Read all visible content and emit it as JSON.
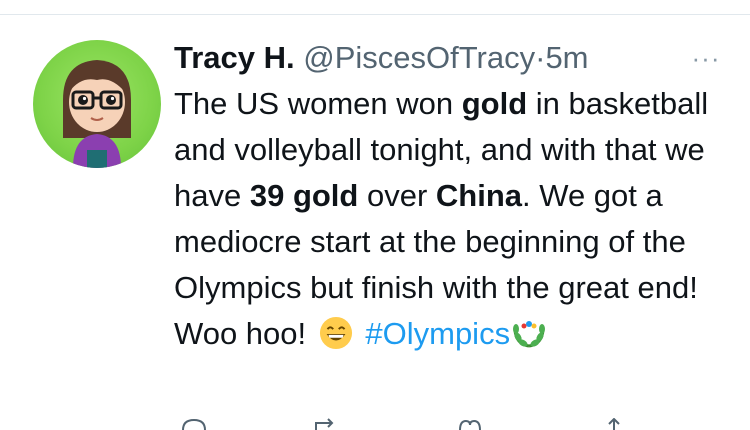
{
  "tweet": {
    "author_name": "Tracy H.",
    "author_handle": "@PiscesOfTracy",
    "separator": "·",
    "timestamp": "5m",
    "more_label": "···",
    "text_runs": [
      {
        "text": "The US women won ",
        "bold": false
      },
      {
        "text": "gold",
        "bold": true
      },
      {
        "text": " in basketball and volleyball tonight, and with that we have ",
        "bold": false
      },
      {
        "text": "39 gold",
        "bold": true
      },
      {
        "text": " over ",
        "bold": false
      },
      {
        "text": "China",
        "bold": true
      },
      {
        "text": ". We got a mediocre start at the beginning of the Olympics but finish with the great end! Woo hoo! ",
        "bold": false
      }
    ],
    "emoji": "grinning-face-with-smiling-eyes",
    "hashtag": "#Olympics",
    "hashtag_emoji": "olympic-laurel"
  },
  "actions": {
    "icons": [
      "reply-icon",
      "retweet-icon",
      "like-icon",
      "share-icon"
    ]
  },
  "colors": {
    "text": "#0f1419",
    "secondary": "#536471",
    "hashtag": "#1d9bf0",
    "divider": "#e1e8ed",
    "avatar_bg": "#7ed348"
  }
}
